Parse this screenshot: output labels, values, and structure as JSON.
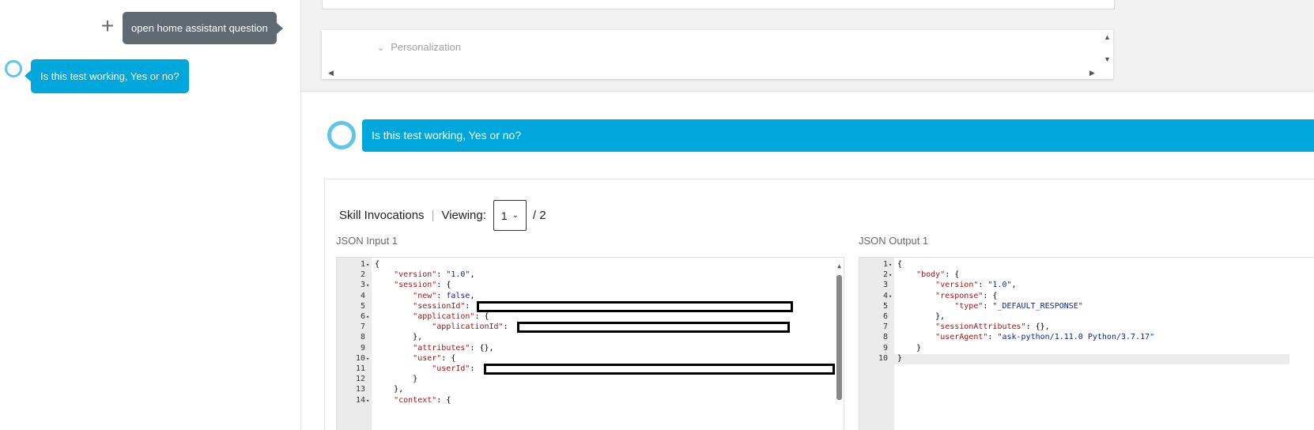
{
  "left": {
    "user_message": "open home assistant question",
    "alexa_message": "Is this test working, Yes or no?"
  },
  "personalization": {
    "label": "Personalization"
  },
  "conversation": {
    "alexa_message": "Is this test working, Yes or no?"
  },
  "skill": {
    "title": "Skill Invocations",
    "viewing_label": "Viewing:",
    "selected": "1",
    "total": "/ 2"
  },
  "json_input": {
    "label": "JSON Input 1",
    "lines": [
      {
        "n": "1",
        "fold": true,
        "text": "{"
      },
      {
        "n": "2",
        "fold": false,
        "text": "    \"version\": \"1.0\","
      },
      {
        "n": "3",
        "fold": true,
        "text": "    \"session\": {"
      },
      {
        "n": "4",
        "fold": false,
        "text": "        \"new\": false,"
      },
      {
        "n": "5",
        "fold": false,
        "text": "        \"sessionId\": "
      },
      {
        "n": "6",
        "fold": true,
        "text": "        \"application\": {"
      },
      {
        "n": "7",
        "fold": false,
        "text": "            \"applicationId\": "
      },
      {
        "n": "8",
        "fold": false,
        "text": "        },"
      },
      {
        "n": "9",
        "fold": false,
        "text": "        \"attributes\": {},"
      },
      {
        "n": "10",
        "fold": true,
        "text": "        \"user\": {"
      },
      {
        "n": "11",
        "fold": false,
        "text": "            \"userId\": "
      },
      {
        "n": "12",
        "fold": false,
        "text": "        }"
      },
      {
        "n": "13",
        "fold": false,
        "text": "    },"
      },
      {
        "n": "14",
        "fold": true,
        "text": "    \"context\": {"
      }
    ]
  },
  "json_output": {
    "label": "JSON Output 1",
    "lines": [
      {
        "n": "1",
        "fold": true,
        "text": "{"
      },
      {
        "n": "2",
        "fold": true,
        "text": "    \"body\": {"
      },
      {
        "n": "3",
        "fold": false,
        "text": "        \"version\": \"1.0\","
      },
      {
        "n": "4",
        "fold": true,
        "text": "        \"response\": {"
      },
      {
        "n": "5",
        "fold": false,
        "text": "            \"type\": \"_DEFAULT_RESPONSE\""
      },
      {
        "n": "6",
        "fold": false,
        "text": "        },"
      },
      {
        "n": "7",
        "fold": false,
        "text": "        \"sessionAttributes\": {},"
      },
      {
        "n": "8",
        "fold": false,
        "text": "        \"userAgent\": \"ask-python/1.11.0 Python/3.7.17\""
      },
      {
        "n": "9",
        "fold": false,
        "text": "    }"
      },
      {
        "n": "10",
        "fold": false,
        "text": "}"
      }
    ]
  },
  "colors": {
    "alexa_blue": "#00a7dd",
    "user_gray": "#5f6a72"
  }
}
